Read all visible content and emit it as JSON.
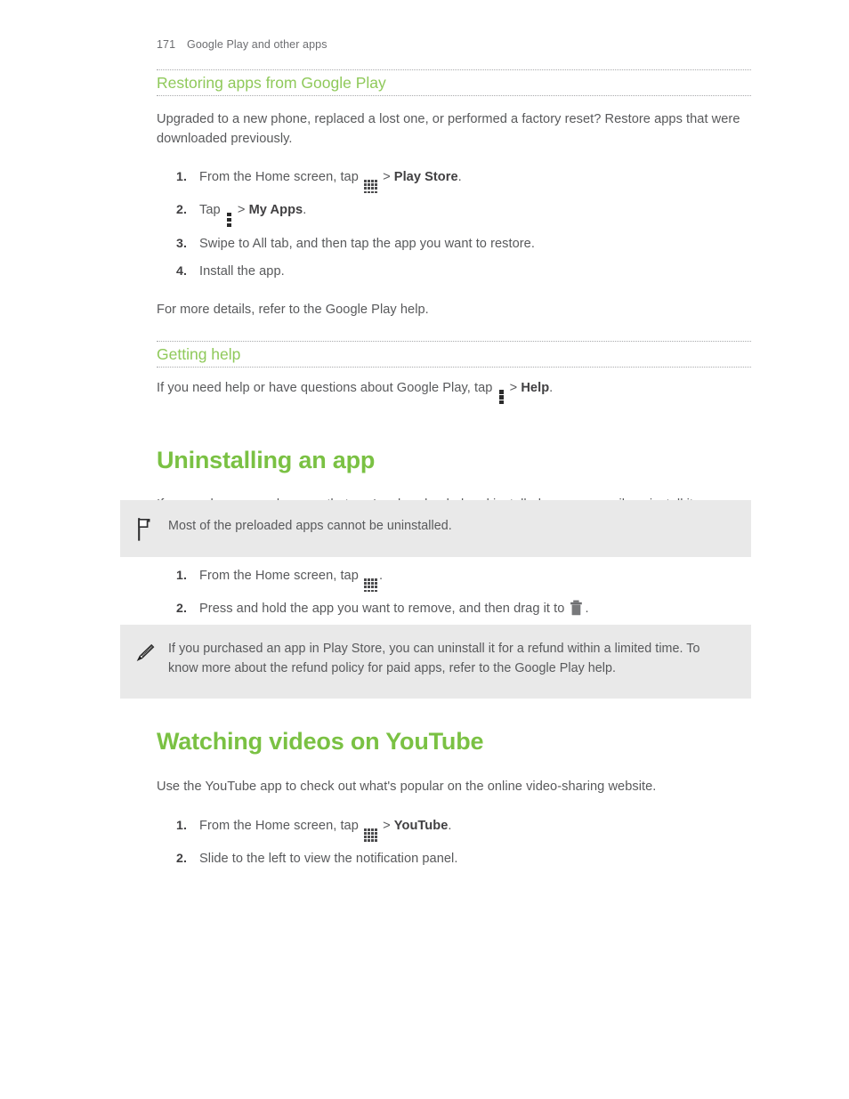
{
  "header": {
    "page_number": "171",
    "chapter": "Google Play and other apps"
  },
  "sections": {
    "restoring": {
      "heading": "Restoring apps from Google Play",
      "intro": "Upgraded to a new phone, replaced a lost one, or performed a factory reset? Restore apps that were downloaded previously.",
      "steps": [
        {
          "prefix": "From the Home screen, tap ",
          "icon": "apps-grid-icon",
          "separator": " > ",
          "bold": "Play Store",
          "suffix": "."
        },
        {
          "prefix": "Tap ",
          "icon": "overflow-menu-icon",
          "separator": " > ",
          "bold": "My Apps",
          "suffix": "."
        },
        {
          "text": "Swipe to All tab, and then tap the app you want to restore."
        },
        {
          "text": "Install the app."
        }
      ],
      "outro": "For more details, refer to the Google Play help."
    },
    "getting_help": {
      "heading": "Getting help",
      "prefix": "If you need help or have questions about Google Play, tap ",
      "icon": "overflow-menu-icon",
      "separator": " > ",
      "bold": "Help",
      "suffix": "."
    },
    "uninstalling": {
      "heading": "Uninstalling an app",
      "intro": "If you no longer need an app that you've downloaded and installed, you can easily uninstall it.",
      "note_flag": {
        "icon": "flag-icon",
        "text": "Most of the preloaded apps cannot be uninstalled."
      },
      "steps": [
        {
          "prefix": "From the Home screen, tap ",
          "icon": "apps-grid-icon",
          "suffix": "."
        },
        {
          "prefix": "Press and hold the app you want to remove, and then drag it to ",
          "icon": "trash-icon",
          "suffix": "."
        }
      ],
      "note_pencil": {
        "icon": "pencil-icon",
        "text": "If you purchased an app in Play Store, you can uninstall it for a refund within a limited time. To know more about the refund policy for paid apps, refer to the Google Play help."
      }
    },
    "youtube": {
      "heading": "Watching videos on YouTube",
      "intro": "Use the YouTube app to check out what's popular on the online video-sharing website.",
      "steps": [
        {
          "prefix": "From the Home screen, tap ",
          "icon": "apps-grid-icon",
          "separator": " > ",
          "bold": "YouTube",
          "suffix": "."
        },
        {
          "text": "Slide to the left to view the notification panel."
        }
      ]
    }
  },
  "colors": {
    "h1_green": "#7ac143",
    "h2_green": "#8fc95a",
    "body_gray": "#58595b",
    "callout_bg": "#e9e9e9"
  }
}
